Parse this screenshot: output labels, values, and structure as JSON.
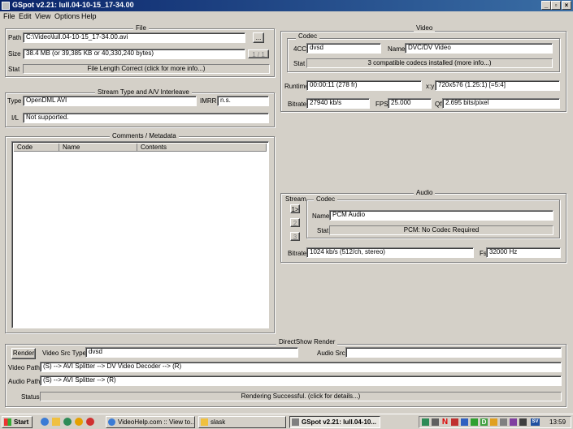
{
  "window": {
    "title": "GSpot v2.21: lull.04-10-15_17-34.00"
  },
  "menu": [
    "File",
    "Edit",
    "View",
    "Options",
    "Help"
  ],
  "file": {
    "group_title": "File",
    "path_label": "Path",
    "path_value": "C:\\Video\\lull.04-10-15_17-34.00.avi",
    "browse_label": "...",
    "size_label": "Size",
    "size_value": "38.4 MB (or 39,385 KB or 40,330,240 bytes)",
    "nav_label": "1 / 1",
    "stat_label": "Stat",
    "stat_value": "File Length Correct (click for more info...)"
  },
  "stream": {
    "group_title": "Stream Type and A/V Interleave",
    "type_label": "Type",
    "type_value": "OpenDML AVI",
    "imrr_label": "IMRR",
    "imrr_value": "n.s.",
    "il_label": "I/L",
    "il_value": "Not supported."
  },
  "comments": {
    "group_title": "Comments / Metadata",
    "columns": [
      "Code",
      "Name",
      "Contents"
    ]
  },
  "video": {
    "group_title": "Video",
    "codec_title": "Codec",
    "fourcc_label": "4CC",
    "fourcc_value": "dvsd",
    "name_label": "Name",
    "name_value": "DVC/DV Video",
    "stat_label": "Stat",
    "stat_value": "3 compatible codecs installed (more info...)",
    "runtime_label": "Runtime",
    "runtime_value": "00:00:11 (278 fr)",
    "xy_label": "x:y",
    "xy_value": "720x576 (1.25:1) [=5:4]",
    "bitrate_label": "Bitrate",
    "bitrate_value": "27940 kb/s",
    "fps_label": "FPS",
    "fps_value": "25.000",
    "qf_label": "Qf",
    "qf_value": "2.695 bits/pixel"
  },
  "audio": {
    "group_title": "Audio",
    "stream_label": "Stream",
    "stream_buttons": [
      "1>",
      "2",
      "3"
    ],
    "codec_title": "Codec",
    "name_label": "Name",
    "name_value": "PCM Audio",
    "stat_label": "Stat",
    "stat_value": "PCM: No Codec Required",
    "bitrate_label": "Bitrate",
    "bitrate_value": "1024 kb/s (512/ch, stereo)",
    "fs_label": "Fs",
    "fs_value": "32000 Hz"
  },
  "render": {
    "group_title": "DirectShow Render",
    "render_button": "Render",
    "video_src_type_label": "Video Src Type",
    "video_src_type_value": "dvsd",
    "audio_src_label": "Audio Src",
    "audio_src_value": "",
    "video_path_label": "Video Path",
    "video_path_value": "(S) --> AVI Splitter --> DV Video Decoder --> (R)",
    "audio_path_label": "Audio Path",
    "audio_path_value": "(S) --> AVI Splitter --> (R)",
    "status_label": "Status",
    "status_value": "Rendering Successful.  (click for details...)"
  },
  "taskbar": {
    "start_label": "Start",
    "tasks": [
      "VideoHelp.com :: View to...",
      "slask",
      "GSpot v2.21: lull.04-10..."
    ],
    "tray_icons": [
      "N",
      "D",
      "SV"
    ],
    "clock": "13:59"
  },
  "colors": {
    "titlebar_start": "#0a246a",
    "titlebar_end": "#3a6ea5",
    "face": "#d4d0c8"
  }
}
